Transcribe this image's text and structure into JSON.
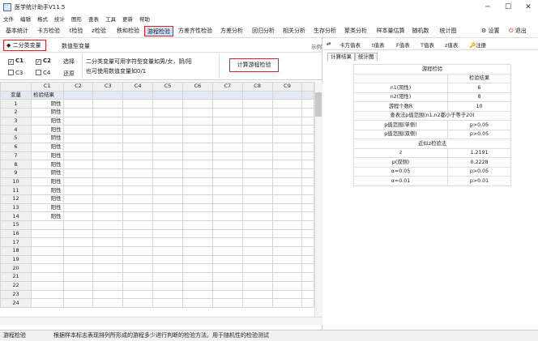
{
  "window": {
    "title": "医学统计助手V11.5",
    "min": "─",
    "max": "☐",
    "close": "✕"
  },
  "menu": [
    "文件",
    "编辑",
    "格式",
    "统计",
    "图形",
    "查表",
    "工具",
    "更新",
    "帮助"
  ],
  "toolbar": {
    "items": [
      "基本统计",
      "卡方检验",
      "t检验",
      "z检验",
      "秩和检验",
      "游程检验",
      "方差齐性检验",
      "方差分析",
      "回归分析",
      "相关分析",
      "生存分析",
      "聚类分析",
      "样本量估算",
      "随机数",
      "统计图"
    ],
    "active": "游程检验",
    "settings": "设置",
    "exit": "退出"
  },
  "options": {
    "binary_tab": "二分类变量",
    "numeric_tab": "数值型变量",
    "example": "示例"
  },
  "vars": {
    "c1": "C1",
    "c2": "C2",
    "c3": "C3",
    "c4": "C4",
    "select": "选择",
    "restore": "还原",
    "c1_checked": true,
    "c2_checked": true
  },
  "desc": {
    "line1": "二分类变量可用字符型变量如男/女，阴/阳",
    "line2": "也可使用数值变量如0/1"
  },
  "calc_button": "计算游程检验",
  "grid": {
    "columns": [
      "C1",
      "C2",
      "C3",
      "C4",
      "C5",
      "C6",
      "C7",
      "C8",
      "C9"
    ],
    "header_row": {
      "label": "变量",
      "c1": "检验结果"
    },
    "rows": [
      [
        "1",
        "阴性"
      ],
      [
        "2",
        "阴性"
      ],
      [
        "3",
        "阳性"
      ],
      [
        "4",
        "阳性"
      ],
      [
        "5",
        "阴性"
      ],
      [
        "6",
        "阳性"
      ],
      [
        "7",
        "阳性"
      ],
      [
        "8",
        "阳性"
      ],
      [
        "9",
        "阴性"
      ],
      [
        "10",
        "阳性"
      ],
      [
        "11",
        "阳性"
      ],
      [
        "12",
        "阳性"
      ],
      [
        "13",
        "阳性"
      ],
      [
        "14",
        "阳性"
      ],
      [
        "15",
        ""
      ],
      [
        "16",
        ""
      ],
      [
        "17",
        ""
      ],
      [
        "18",
        ""
      ],
      [
        "19",
        ""
      ],
      [
        "20",
        ""
      ],
      [
        "21",
        ""
      ],
      [
        "22",
        ""
      ],
      [
        "23",
        ""
      ],
      [
        "24",
        ""
      ]
    ]
  },
  "right_tools": [
    "卡方值表",
    "t值表",
    "F值表",
    "T值表",
    "z值表",
    "注册"
  ],
  "right_tabs": [
    "计算结果",
    "统计图"
  ],
  "results": {
    "title": "游程检验",
    "col_header": "检验结果",
    "rows": [
      [
        "n1(阴性)",
        "6"
      ],
      [
        "n2(阳性)",
        "8"
      ],
      [
        "游程个数R",
        "10"
      ],
      [
        "查表法p值范围(n1,n2都小于等于20)",
        ""
      ],
      [
        "p值范围(单侧)",
        "p>0.05"
      ],
      [
        "p值范围(双侧)",
        "p>0.05"
      ],
      [
        "近似z检验法",
        ""
      ],
      [
        "z",
        "1.2191"
      ],
      [
        "p(双侧)",
        "0.2228"
      ],
      [
        "α=0.05",
        "p>0.05"
      ],
      [
        "α=0.01",
        "p>0.01"
      ]
    ]
  },
  "status": {
    "left": "游程检验",
    "message": "根据样本标志表现排列所形成的游程多少进行判断的检验方法。用于随机性的检验测试"
  }
}
